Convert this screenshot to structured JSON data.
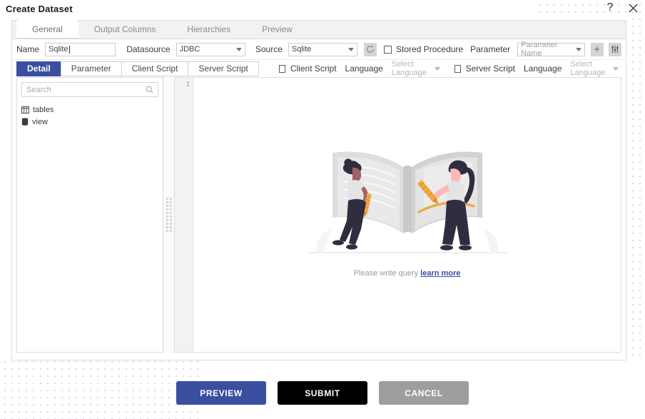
{
  "window": {
    "title": "Create Dataset",
    "help_icon": "question-mark-icon",
    "close_icon": "close-icon"
  },
  "tabs": [
    {
      "label": "General",
      "active": true
    },
    {
      "label": "Output Columns",
      "active": false
    },
    {
      "label": "Hierarchies",
      "active": false
    },
    {
      "label": "Preview",
      "active": false
    }
  ],
  "form": {
    "name_label": "Name",
    "name_value": "Sqlite",
    "name_placeholder": "",
    "datasource_label": "Datasource",
    "datasource_value": "JDBC",
    "source_label": "Source",
    "source_value": "Sqlite",
    "refresh_icon": "refresh-icon",
    "stored_procedure_label": "Stored Procedure",
    "stored_procedure_checked": false,
    "parameter_label": "Parameter",
    "parameter_name_value": "Parameter Name",
    "add_icon": "plus-icon",
    "settings_icon": "sliders-icon"
  },
  "subtabs": [
    {
      "label": "Detail",
      "active": true
    },
    {
      "label": "Parameter",
      "active": false
    },
    {
      "label": "Client Script",
      "active": false
    },
    {
      "label": "Server Script",
      "active": false
    }
  ],
  "script_options": {
    "client_script_label": "Client Script",
    "client_script_checked": false,
    "client_language_label": "Language",
    "client_language_value": "Select Language",
    "server_script_label": "Server Script",
    "server_script_checked": false,
    "server_language_label": "Language",
    "server_language_value": "Select Language"
  },
  "explorer": {
    "search_placeholder": "Search",
    "search_icon": "search-icon",
    "items": [
      {
        "label": "tables",
        "icon": "table-icon"
      },
      {
        "label": "view",
        "icon": "database-icon"
      }
    ]
  },
  "editor": {
    "line_numbers": [
      "1"
    ],
    "empty_message": "Please write query",
    "empty_link": "learn more",
    "illustration": "two-people-writing-in-book-illustration"
  },
  "footer": {
    "preview_label": "PREVIEW",
    "submit_label": "SUBMIT",
    "cancel_label": "CANCEL"
  },
  "colors": {
    "accent": "#3b4fa0",
    "submit": "#000000",
    "cancel": "#9e9e9e",
    "dot_pattern": "#8a9bd6",
    "pencil": "#f0a93b"
  }
}
